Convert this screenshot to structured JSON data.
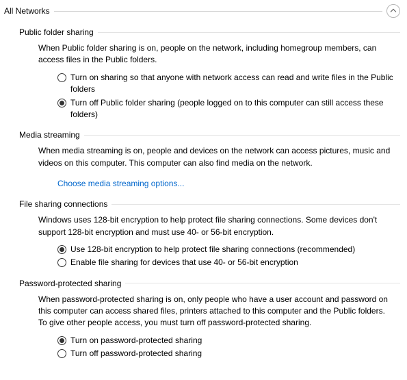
{
  "section": {
    "title": "All Networks"
  },
  "public_folder": {
    "title": "Public folder sharing",
    "desc": "When Public folder sharing is on, people on the network, including homegroup members, can access files in the Public folders.",
    "opt_on": "Turn on sharing so that anyone with network access can read and write files in the Public folders",
    "opt_off": "Turn off Public folder sharing (people logged on to this computer can still access these folders)"
  },
  "media": {
    "title": "Media streaming",
    "desc": "When media streaming is on, people and devices on the network can access pictures, music and videos on this computer. This computer can also find media on the network.",
    "link": "Choose media streaming options..."
  },
  "file_sharing": {
    "title": "File sharing connections",
    "desc": "Windows uses 128-bit encryption to help protect file sharing connections. Some devices don't support 128-bit encryption and must use 40- or 56-bit encryption.",
    "opt_128": "Use 128-bit encryption to help protect file sharing connections (recommended)",
    "opt_40": "Enable file sharing for devices that use 40- or 56-bit encryption"
  },
  "password": {
    "title": "Password-protected sharing",
    "desc": "When password-protected sharing is on, only people who have a user account and password on this computer can access shared files, printers attached to this computer and the Public folders. To give other people access, you must turn off password-protected sharing.",
    "opt_on": "Turn on password-protected sharing",
    "opt_off": "Turn off password-protected sharing"
  }
}
